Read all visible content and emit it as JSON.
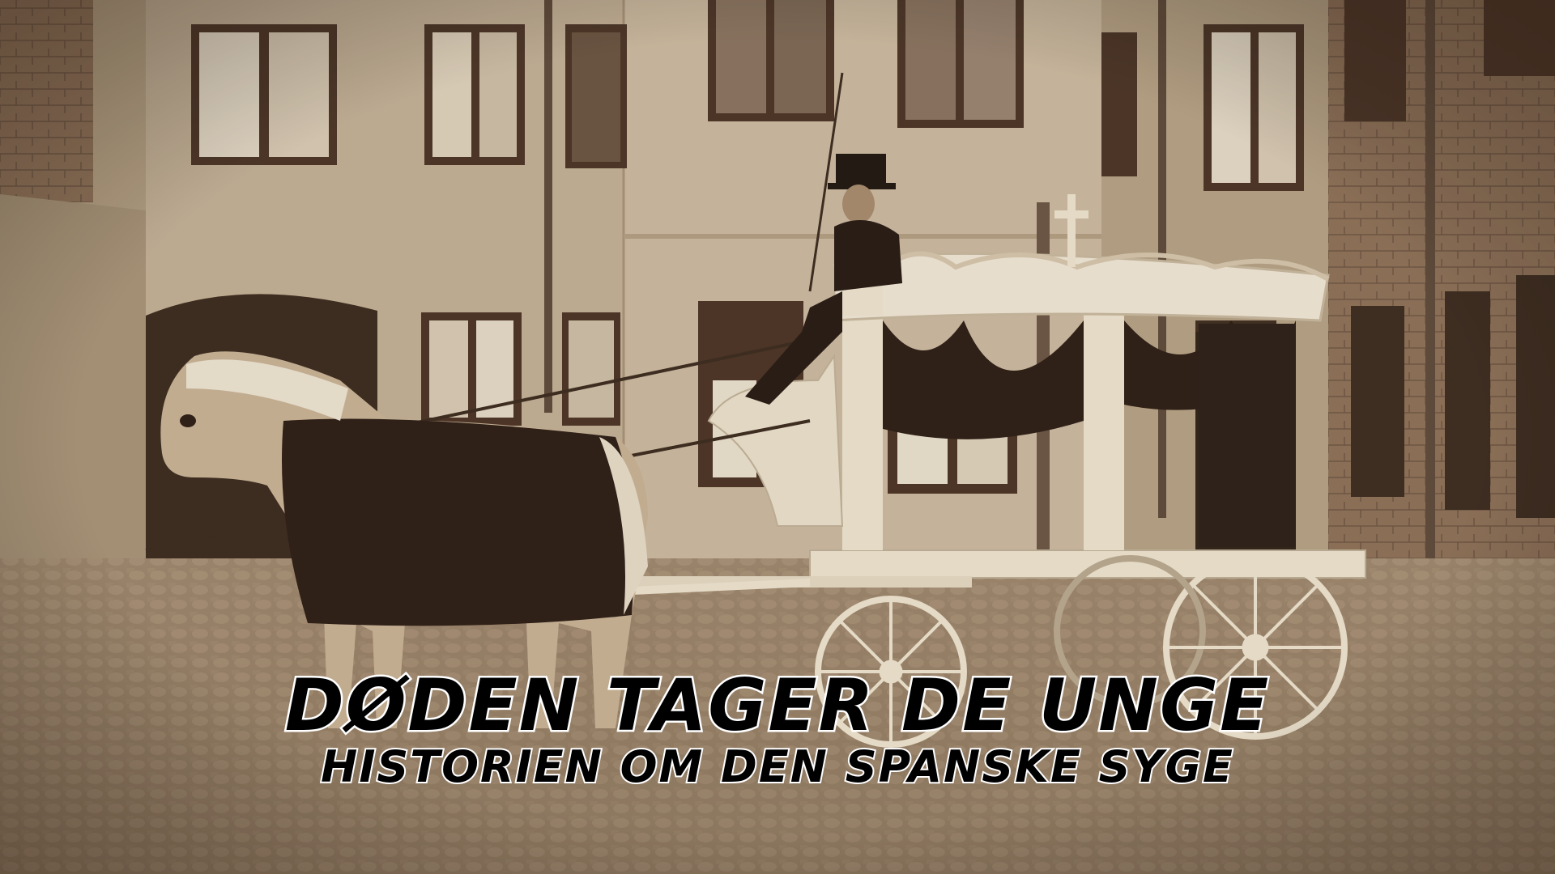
{
  "title": {
    "main": "DØDEN TAGER DE UNGE",
    "subtitle": "HISTORIEN OM DEN SPANSKE SYGE"
  },
  "photo": {
    "tone": "sepia",
    "colors": {
      "wall_light": "#cdbba3",
      "wall_mid": "#b09a7e",
      "brick": "#8a6c55",
      "window_frame": "#4a3428",
      "cobbles": "#9c8670",
      "hearse": "#efe6d4",
      "drape": "#2b1d17",
      "horse": "#c9b59a"
    },
    "subjects": [
      "building-facade",
      "cobblestone-courtyard",
      "horse",
      "hearse-carriage",
      "coachman-top-hat",
      "brick-wall"
    ]
  }
}
